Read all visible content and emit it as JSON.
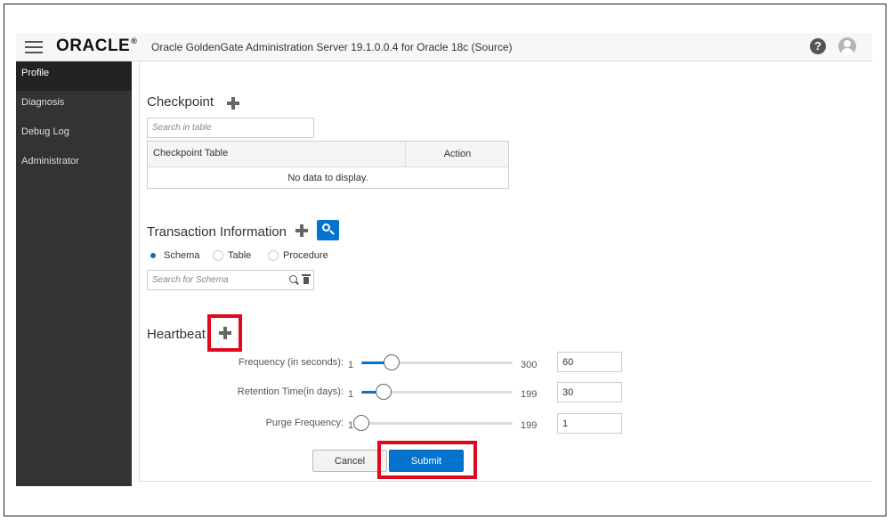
{
  "header": {
    "logo": "ORACLE",
    "logo_mark": "®",
    "title": "Oracle GoldenGate Administration Server 19.1.0.0.4 for Oracle 18c (Source)",
    "help_icon": "?"
  },
  "sidebar": {
    "items": [
      {
        "label": "Profile",
        "active": true
      },
      {
        "label": "Diagnosis",
        "active": false
      },
      {
        "label": "Debug Log",
        "active": false
      },
      {
        "label": "Administrator",
        "active": false
      }
    ]
  },
  "checkpoint": {
    "title": "Checkpoint",
    "search_placeholder": "Search in table",
    "columns": [
      "Checkpoint Table",
      "Action"
    ],
    "empty_message": "No data to display."
  },
  "transaction": {
    "title": "Transaction Information",
    "radios": [
      {
        "label": "Schema",
        "checked": true
      },
      {
        "label": "Table",
        "checked": false
      },
      {
        "label": "Procedure",
        "checked": false
      }
    ],
    "search_placeholder": "Search for Schema"
  },
  "heartbeat": {
    "title": "Heartbeat",
    "sliders": [
      {
        "label": "Frequency (in seconds):",
        "min": 1,
        "max": 300,
        "value": 60,
        "display_min": "1",
        "display_max": "300",
        "input_value": "60"
      },
      {
        "label": "Retention Time(in days):",
        "min": 1,
        "max": 199,
        "value": 30,
        "display_min": "1",
        "display_max": "199",
        "input_value": "30"
      },
      {
        "label": "Purge Frequency:",
        "min": 1,
        "max": 199,
        "value": 1,
        "display_min": "1",
        "display_max": "199",
        "input_value": "1"
      }
    ]
  },
  "actions": {
    "cancel_label": "Cancel",
    "submit_label": "Submit"
  },
  "colors": {
    "accent": "#0572ce",
    "highlight": "#e0081d",
    "sidebar_bg": "#333333"
  }
}
